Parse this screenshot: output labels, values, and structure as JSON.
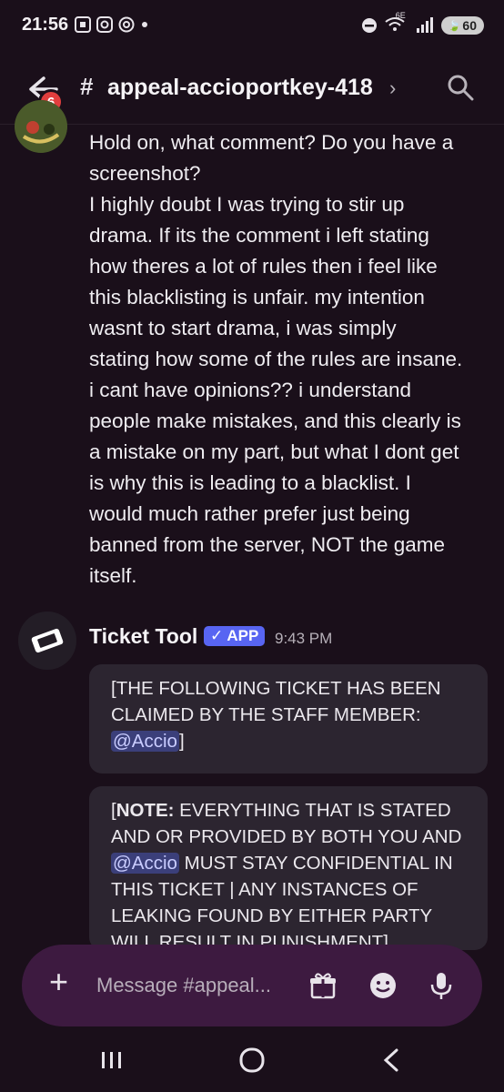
{
  "status": {
    "time": "21:56",
    "network": "6E",
    "battery": "60"
  },
  "header": {
    "badge_count": "6",
    "channel_name": "appeal-accioportkey-418",
    "hash": "#"
  },
  "messages": {
    "first": {
      "line1": "Hold on, what comment? Do you have a\nscreenshot?",
      "line2": "I highly doubt I was trying to stir up\ndrama. If its the comment i left stating\nhow theres a lot of rules then i feel like\nthis blacklisting is unfair. my intention\nwasnt to start drama, i was simply\nstating how some of the rules are insane.\ni cant have opinions?? i understand\npeople make mistakes, and this clearly is\na mistake on my part, but what I dont get\nis why this is leading to a blacklist. I\nwould much rather prefer just being\nbanned from the server, NOT the game\nitself."
    },
    "bot": {
      "author": "Ticket Tool",
      "app_badge": "✓ APP",
      "timestamp": "9:43 PM",
      "embed1_text": "[THE FOLLOWING TICKET HAS BEEN CLAIMED BY THE STAFF MEMBER: ",
      "embed1_mention": "@Accio",
      "embed1_end": "]",
      "embed2_open": "[",
      "embed2_bold": "NOTE:",
      "embed2_text_a": " EVERYTHING THAT IS STATED AND OR PROVIDED BY BOTH YOU AND ",
      "embed2_mention": "@Accio",
      "embed2_text_b": " MUST STAY CONFIDENTIAL IN THIS TICKET | ANY INSTANCES OF LEAKING FOUND BY EITHER PARTY WILL RESULT IN PUNISHMENT]"
    }
  },
  "composer": {
    "placeholder": "Message #appeal..."
  },
  "colors": {
    "background": "#1a0f1a",
    "composer": "#3d1a40",
    "embed": "#2c2530",
    "mention": "#3b3f7a",
    "app_badge": "#5865f2",
    "badge": "#e03e3e"
  },
  "icons": {
    "back": "arrow-left-icon",
    "search": "search-icon",
    "plus": "plus-icon",
    "gift": "gift-icon",
    "emoji": "emoji-icon",
    "mic": "microphone-icon",
    "bot_avatar": "ticket-icon"
  }
}
